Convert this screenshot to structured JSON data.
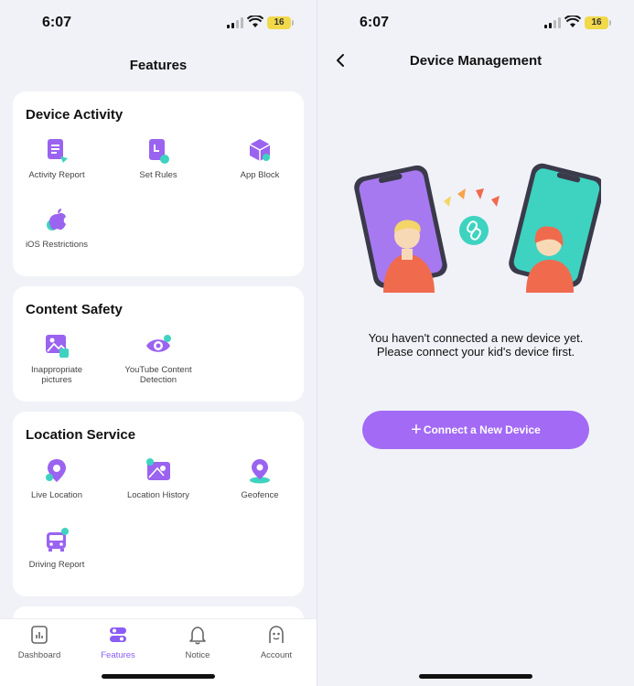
{
  "status_bar": {
    "time": "6:07",
    "battery": "16"
  },
  "features_screen": {
    "title": "Features",
    "sections": [
      {
        "title": "Device Activity",
        "items": [
          {
            "label": "Activity Report",
            "icon": "activity-report-icon"
          },
          {
            "label": "Set Rules",
            "icon": "set-rules-icon"
          },
          {
            "label": "App Block",
            "icon": "app-block-icon"
          },
          {
            "label": "iOS Restrictions",
            "icon": "apple-icon"
          }
        ]
      },
      {
        "title": "Content Safety",
        "items": [
          {
            "label": "Inappropriate pictures",
            "icon": "image-icon"
          },
          {
            "label": "YouTube Content Detection",
            "icon": "eye-icon"
          }
        ]
      },
      {
        "title": "Location Service",
        "items": [
          {
            "label": "Live Location",
            "icon": "location-pin-icon"
          },
          {
            "label": "Location History",
            "icon": "map-history-icon"
          },
          {
            "label": "Geofence",
            "icon": "geofence-icon"
          },
          {
            "label": "Driving Report",
            "icon": "car-icon"
          }
        ]
      }
    ],
    "tabbar": [
      {
        "label": "Dashboard",
        "icon": "dashboard-icon"
      },
      {
        "label": "Features",
        "icon": "features-icon",
        "active": true
      },
      {
        "label": "Notice",
        "icon": "bell-icon"
      },
      {
        "label": "Account",
        "icon": "account-icon"
      }
    ]
  },
  "device_management_screen": {
    "title": "Device Management",
    "message_line1": "You haven't connected a new device yet.",
    "message_line2": "Please connect your kid's device first.",
    "connect_button": "Connect a New Device"
  },
  "colors": {
    "accent": "#8a5cf5",
    "button": "#a26af5",
    "teal": "#3ed3c0",
    "background": "#f1f2f8"
  }
}
